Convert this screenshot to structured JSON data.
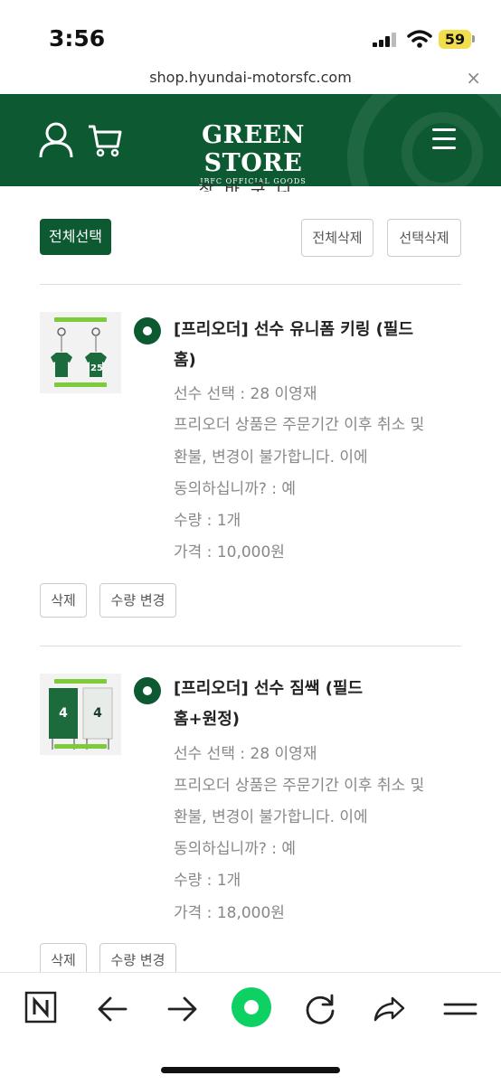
{
  "status_bar": {
    "time": "3:56",
    "battery": "59"
  },
  "browser": {
    "url": "shop.hyundai-motorsfc.com",
    "close_label": "×"
  },
  "header": {
    "logo_main": "GREEN STORE",
    "logo_sub": "JBFC OFFICIAL GOODS"
  },
  "page": {
    "cut_title": "장바구니"
  },
  "actions": {
    "select_all": "전체선택",
    "delete_all": "전체삭제",
    "delete_selected": "선택삭제"
  },
  "items": [
    {
      "title_line1": "[프리오더] 선수 유니폼 키링 (필드",
      "title_line2": "홈)",
      "player": "선수 선택 : 28 이영재",
      "notice_line1": "프리오더 상품은 주문기간 이후 취소 및",
      "notice_line2": "환불, 변경이 불가합니다. 이에",
      "notice_line3": "동의하십니까? : 예",
      "qty": "수량 : 1개",
      "price": "가격 : 10,000원",
      "delete_label": "삭제",
      "change_qty_label": "수량 변경",
      "thumb_number": "25"
    },
    {
      "title_line1": "[프리오더] 선수 짐쌕 (필드",
      "title_line2": "홈+원정)",
      "player": "선수 선택 : 28 이영재",
      "notice_line1": "프리오더 상품은 주문기간 이후 취소 및",
      "notice_line2": "환불, 변경이 불가합니다. 이에",
      "notice_line3": "동의하십니까? : 예",
      "qty": "수량 : 1개",
      "price": "가격 : 18,000원",
      "delete_label": "삭제",
      "change_qty_label": "수량 변경",
      "thumb_number": "4"
    }
  ],
  "colors": {
    "brand_green": "#0d5a32",
    "toolbar_accent": "#0ed163"
  },
  "toolbar_icons": [
    "naver-n-icon",
    "back-arrow-icon",
    "forward-arrow-icon",
    "home-dot-icon",
    "refresh-icon",
    "share-icon",
    "menu-icon"
  ]
}
